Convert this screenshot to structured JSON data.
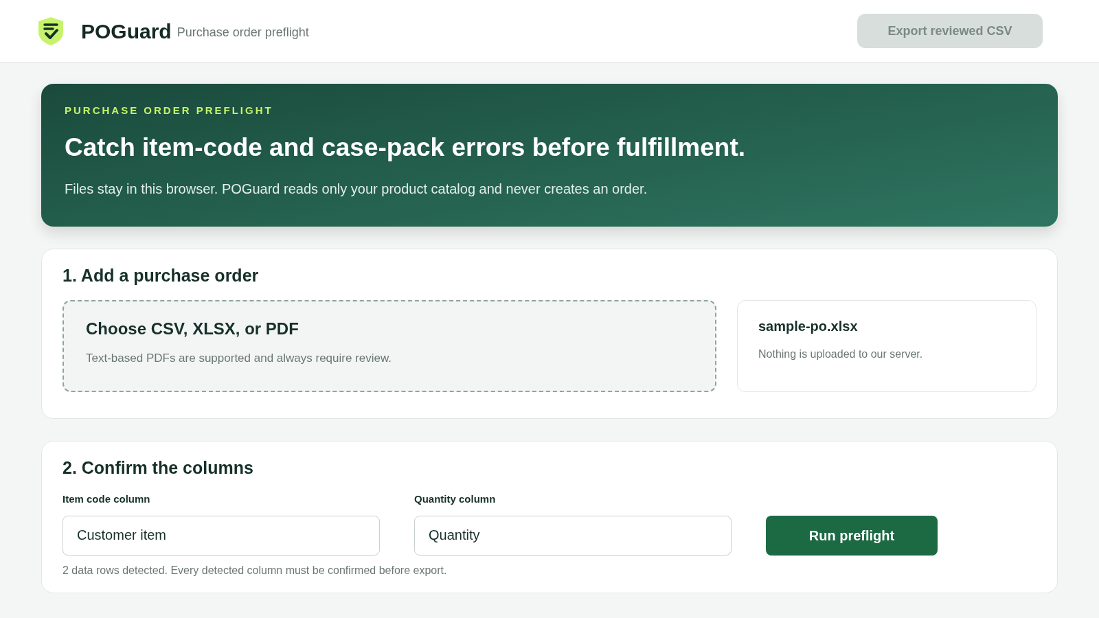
{
  "header": {
    "brand": "POGuard",
    "tagline": "Purchase order preflight",
    "export_button": {
      "label": "Export reviewed CSV",
      "disabled": true
    }
  },
  "hero": {
    "eyebrow": "PURCHASE ORDER PREFLIGHT",
    "title": "Catch item-code and case-pack errors before fulfillment.",
    "subtitle": "Files stay in this browser. POGuard reads only your product catalog and never creates an order."
  },
  "step_1": {
    "title": "1. Add a purchase order",
    "dropzone": {
      "title": "Choose CSV, XLSX, or PDF",
      "hint": "Text-based PDFs are supported and always require review."
    },
    "file": {
      "name": "sample-po.xlsx",
      "note": "Nothing is uploaded to our server."
    }
  },
  "step_2": {
    "title": "2. Confirm the columns",
    "fields": [
      {
        "label": "Item code column",
        "value": "Customer item"
      },
      {
        "label": "Quantity column",
        "value": "Quantity"
      }
    ],
    "run_button": "Run preflight",
    "note": "2 data rows detected. Every detected column must be confirmed before export."
  }
}
